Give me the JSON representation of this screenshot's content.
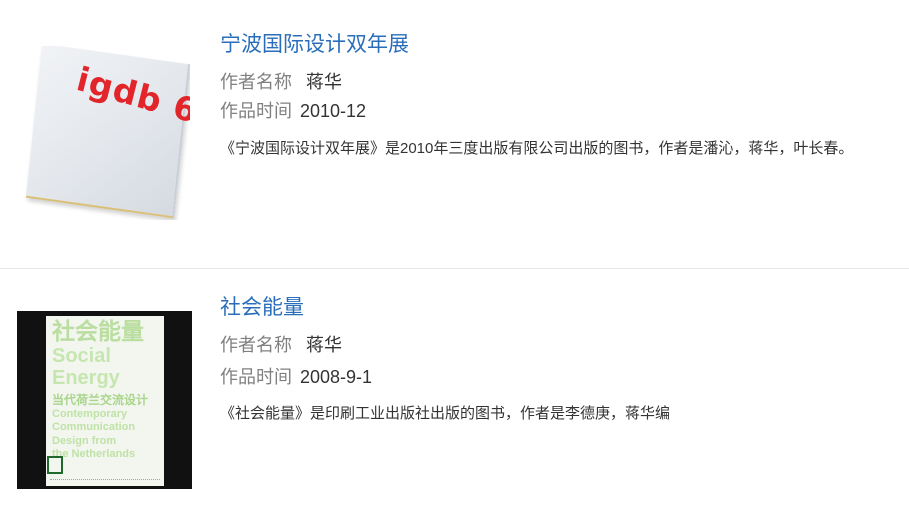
{
  "items": [
    {
      "title": "宁波国际设计双年展",
      "author_label": "作者名称",
      "author": "蒋华",
      "time_label": "作品时间",
      "time": "2010-12",
      "description": "《宁波国际设计双年展》是2010年三度出版有限公司出版的图书，作者是潘沁，蒋华，叶长春。",
      "cover_text": "igdb 6",
      "cover_color": "#e2252b"
    },
    {
      "title": "社会能量",
      "author_label": "作者名称",
      "author": "蒋华",
      "time_label": "作品时间",
      "time": "2008-9-1",
      "description": "《社会能量》是印刷工业出版社出版的图书，作者是李德庚，蒋华编",
      "cover_lines": [
        "社会能量",
        "Social",
        "Energy",
        "当代荷兰交流设计",
        "Contemporary",
        "Communication",
        "Design from",
        "the Netherlands"
      ],
      "cover_color": "#c8e6b4"
    }
  ],
  "colors": {
    "title_link": "#2a6ebb",
    "label": "#808080",
    "text": "#333333",
    "divider": "#e6e6e6"
  }
}
